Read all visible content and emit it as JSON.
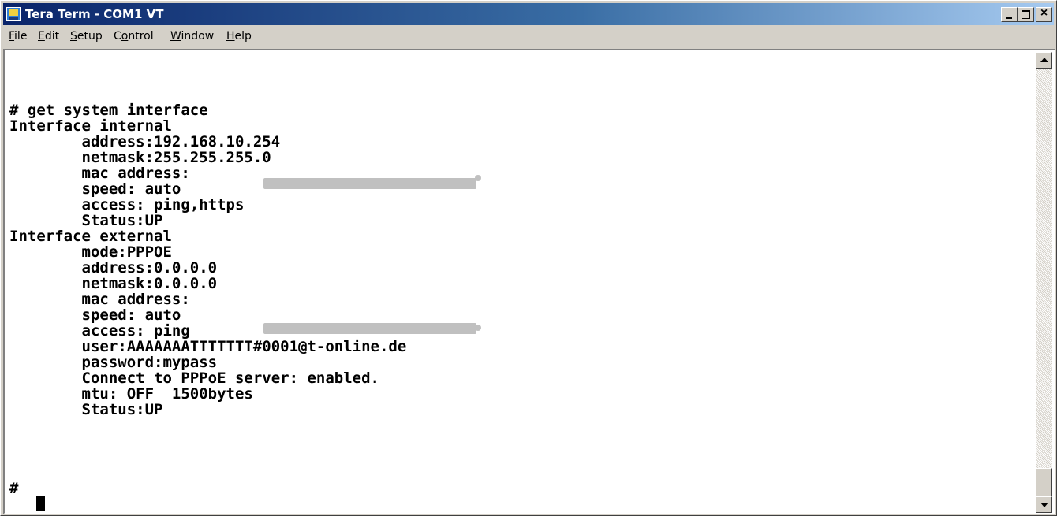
{
  "window": {
    "title": "Tera Term - COM1 VT",
    "app_icon": "teraterm-icon",
    "controls": {
      "minimize": "minimize-icon",
      "maximize": "maximize-icon",
      "close": "×"
    }
  },
  "menu": [
    {
      "pre": "",
      "key": "F",
      "post": "ile"
    },
    {
      "pre": "",
      "key": "E",
      "post": "dit"
    },
    {
      "pre": "",
      "key": "S",
      "post": "etup"
    },
    {
      "pre": "C",
      "key": "o",
      "post": "ntrol"
    },
    {
      "pre": "",
      "key": "W",
      "post": "indow"
    },
    {
      "pre": "",
      "key": "H",
      "post": "elp"
    }
  ],
  "terminal": {
    "lines": [
      "# get system interface",
      "Interface internal",
      "        address:192.168.10.254",
      "        netmask:255.255.255.0",
      "        mac address:",
      "        speed: auto",
      "        access: ping,https",
      "        Status:UP",
      "Interface external",
      "        mode:PPPOE",
      "        address:0.0.0.0",
      "        netmask:0.0.0.0",
      "        mac address:",
      "        speed: auto",
      "        access: ping",
      "        user:AAAAAAATTTTTTT#0001@t-online.de",
      "        password:mypass",
      "        Connect to PPPoE server: enabled.",
      "        mtu: OFF  1500bytes",
      "        Status:UP",
      "",
      "# "
    ]
  },
  "colors": {
    "title_start": "#0a246a",
    "title_end": "#a6caf0",
    "chrome": "#d4d0c8",
    "terminal_bg": "#ffffff",
    "terminal_fg": "#000000"
  }
}
